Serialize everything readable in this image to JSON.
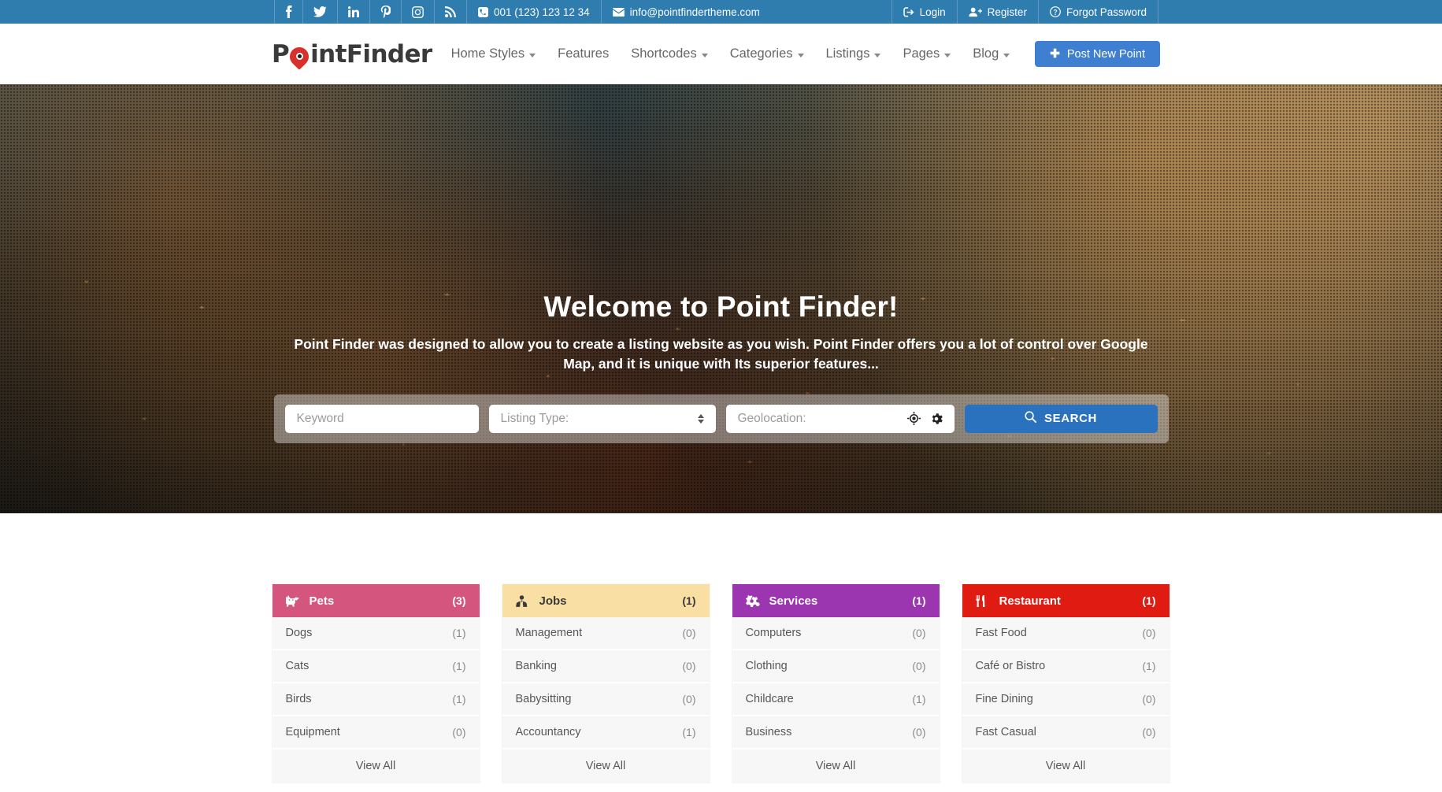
{
  "topbar": {
    "socials": [
      {
        "name": "facebook-icon",
        "glyph": "f"
      },
      {
        "name": "twitter-icon",
        "glyph": "t"
      },
      {
        "name": "linkedin-icon",
        "glyph": "in"
      },
      {
        "name": "pinterest-icon",
        "glyph": "P"
      },
      {
        "name": "instagram-icon",
        "glyph": "ig"
      },
      {
        "name": "rss-icon",
        "glyph": "rss"
      }
    ],
    "phone": "001 (123) 123 12 34",
    "email": "info@pointfindertheme.com",
    "login": "Login",
    "register": "Register",
    "forgot": "Forgot Password"
  },
  "header": {
    "logo_part1": "P",
    "logo_part2": "int",
    "logo_part3": "Finder",
    "nav": [
      {
        "label": "Home Styles",
        "caret": true
      },
      {
        "label": "Features",
        "caret": false
      },
      {
        "label": "Shortcodes",
        "caret": true
      },
      {
        "label": "Categories",
        "caret": true
      },
      {
        "label": "Listings",
        "caret": true
      },
      {
        "label": "Pages",
        "caret": true
      },
      {
        "label": "Blog",
        "caret": true
      }
    ],
    "post_button": "Post New Point",
    "post_button_color": "#3e7fd1"
  },
  "hero": {
    "title": "Welcome to Point Finder!",
    "subtitle": "Point Finder was designed to allow you to create a listing website as you wish. Point Finder offers you a lot of control over Google Map, and it is unique with Its superior features..."
  },
  "search": {
    "keyword_placeholder": "Keyword",
    "listing_type_value": "Listing Type:",
    "geolocation_placeholder": "Geolocation:",
    "search_button": "SEARCH",
    "search_button_color": "#2a72bd"
  },
  "categories": [
    {
      "title": "Pets",
      "count": "(3)",
      "color": "#d4567f",
      "text_color": "#ffffff",
      "icon": "cat-icon",
      "items": [
        {
          "label": "Dogs",
          "count": "(1)"
        },
        {
          "label": "Cats",
          "count": "(1)"
        },
        {
          "label": "Birds",
          "count": "(1)"
        },
        {
          "label": "Equipment",
          "count": "(0)"
        }
      ],
      "view_all": "View All"
    },
    {
      "title": "Jobs",
      "count": "(1)",
      "color": "#fadfa4",
      "text_color": "#3a3a3a",
      "icon": "user-tie-icon",
      "items": [
        {
          "label": "Management",
          "count": "(0)"
        },
        {
          "label": "Banking",
          "count": "(0)"
        },
        {
          "label": "Babysitting",
          "count": "(0)"
        },
        {
          "label": "Accountancy",
          "count": "(1)"
        }
      ],
      "view_all": "View All"
    },
    {
      "title": "Services",
      "count": "(1)",
      "color": "#9b35b0",
      "text_color": "#ffffff",
      "icon": "cogs-icon",
      "items": [
        {
          "label": "Computers",
          "count": "(0)"
        },
        {
          "label": "Clothing",
          "count": "(0)"
        },
        {
          "label": "Childcare",
          "count": "(1)"
        },
        {
          "label": "Business",
          "count": "(0)"
        }
      ],
      "view_all": "View All"
    },
    {
      "title": "Restaurant",
      "count": "(1)",
      "color": "#e01b11",
      "text_color": "#ffffff",
      "icon": "utensils-icon",
      "items": [
        {
          "label": "Fast Food",
          "count": "(0)"
        },
        {
          "label": "Café or Bistro",
          "count": "(1)"
        },
        {
          "label": "Fine Dining",
          "count": "(0)"
        },
        {
          "label": "Fast Casual",
          "count": "(0)"
        }
      ],
      "view_all": "View All"
    }
  ]
}
